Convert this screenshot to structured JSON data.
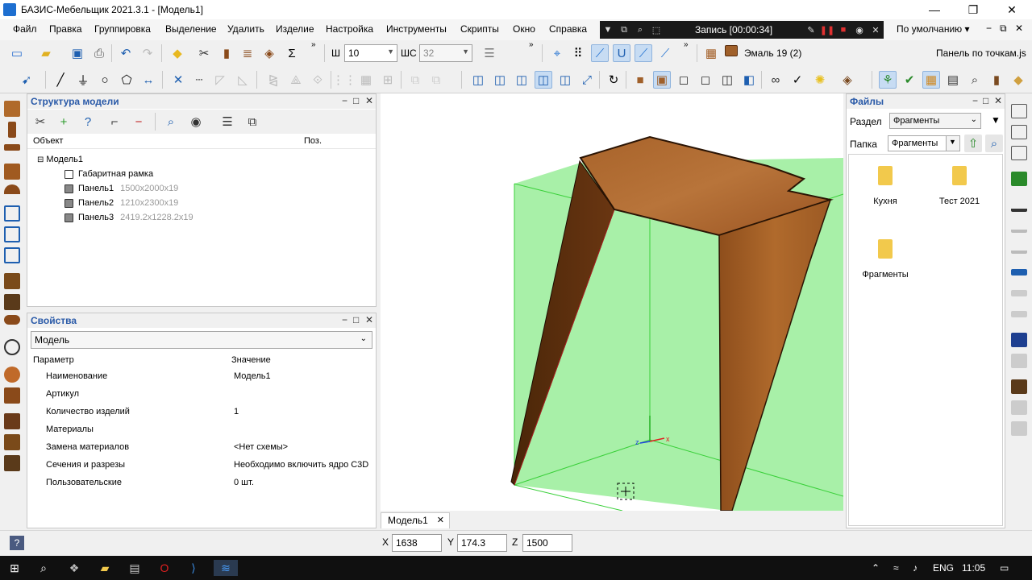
{
  "window": {
    "title": "БАЗИС-Мебельщик 2021.3.1 - [Модель1]",
    "minimize": "—",
    "maximize": "❐",
    "close": "✕"
  },
  "menu": [
    "Файл",
    "Правка",
    "Группировка",
    "Выделение",
    "Удалить",
    "Изделие",
    "Настройка",
    "Инструменты",
    "Скрипты",
    "Окно",
    "Справка"
  ],
  "recorder": {
    "label": "Запись [00:00:34]"
  },
  "workspace": {
    "default_label": "По умолчанию ▾"
  },
  "toolbar": {
    "width_label": "Ш",
    "width_value": "10",
    "width2_label": "ШС",
    "width2_value": "32",
    "material_name": "Эмаль 19 (2)",
    "script_name": "Панель по точкам.js"
  },
  "structure_panel": {
    "title": "Структура модели",
    "col_object": "Объект",
    "col_pos": "Поз.",
    "root": "Модель1",
    "items": [
      {
        "name": "Габаритная рамка",
        "dims": ""
      },
      {
        "name": "Панель1",
        "dims": "1500x2000x19"
      },
      {
        "name": "Панель2",
        "dims": "1210x2300x19"
      },
      {
        "name": "Панель3",
        "dims": "2419.2x1228.2x19"
      }
    ]
  },
  "properties_panel": {
    "title": "Свойства",
    "selected": "Модель",
    "col_param": "Параметр",
    "col_value": "Значение",
    "rows": [
      {
        "param": "Наименование",
        "value": "Модель1"
      },
      {
        "param": "Артикул",
        "value": ""
      },
      {
        "param": "Количество изделий",
        "value": "1"
      },
      {
        "param": "Материалы",
        "value": ""
      },
      {
        "param": "Замена материалов",
        "value": "<Нет схемы>"
      },
      {
        "param": "Сечения и разрезы",
        "value": "Необходимо включить ядро C3D"
      },
      {
        "param": "Пользовательские",
        "value": "0 шт."
      }
    ]
  },
  "viewport": {
    "tab_label": "Модель1"
  },
  "files_panel": {
    "title": "Файлы",
    "section_label": "Раздел",
    "section_value": "Фрагменты",
    "folder_label": "Папка",
    "folder_value": "Фрагменты",
    "folders": [
      "Кухня",
      "Тест 2021",
      "Фрагменты"
    ]
  },
  "coords": {
    "x_label": "X",
    "x": "1638",
    "y_label": "Y",
    "y": "174.3",
    "z_label": "Z",
    "z": "1500"
  },
  "taskbar": {
    "lang": "ENG",
    "time": "11:05"
  },
  "colors": {
    "accent": "#2a5aa8",
    "wood": "#a0602a",
    "bbox": "#9ef09e"
  }
}
